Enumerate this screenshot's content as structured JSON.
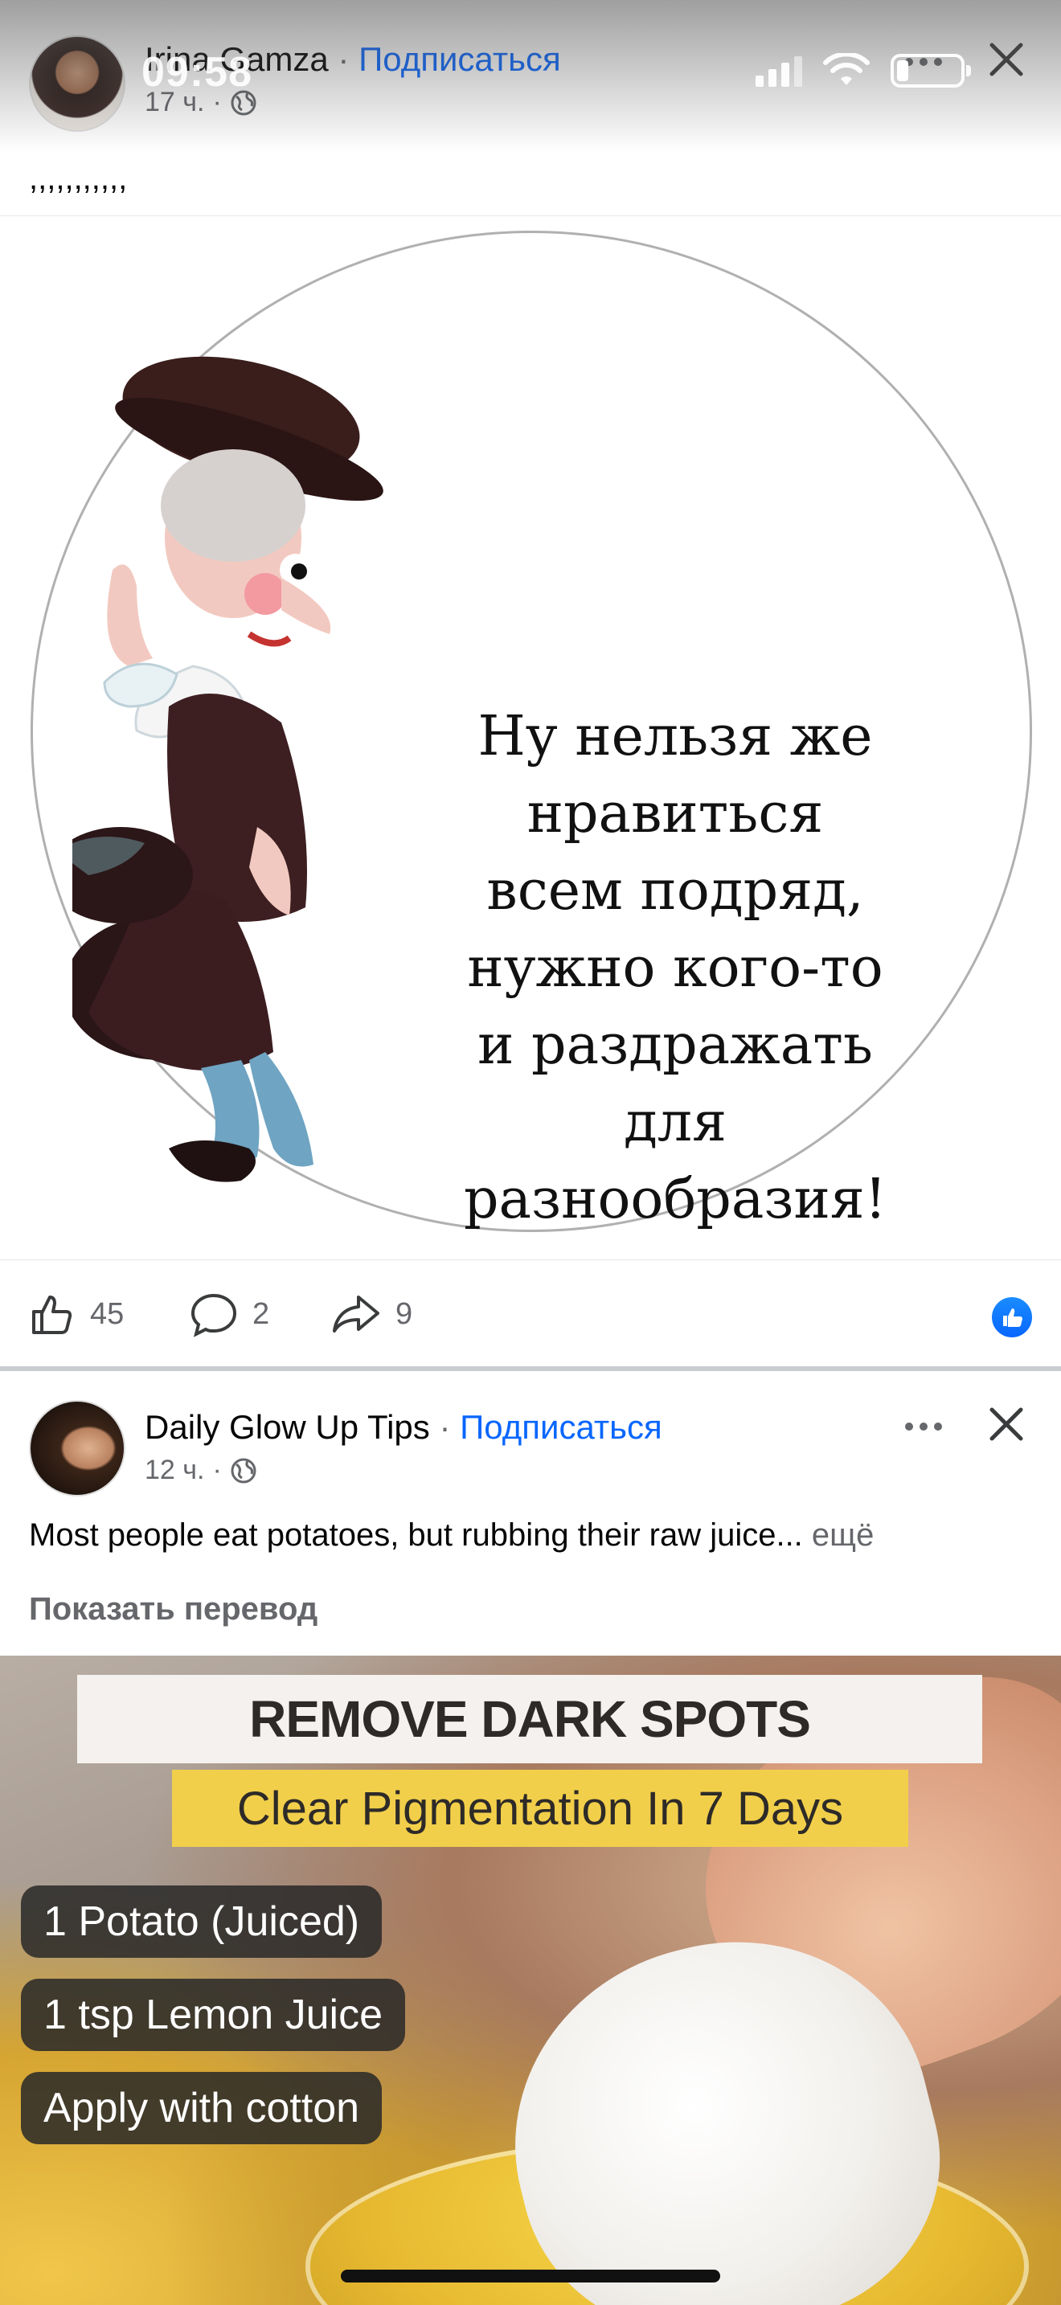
{
  "status_bar": {
    "time": "09:58"
  },
  "post1": {
    "author": "Irina Gamza",
    "separator": "·",
    "subscribe": "Подписаться",
    "time": "17 ч.",
    "meta_separator": "·",
    "text": ",,,,,,,,,,,",
    "meme_lines": [
      "Ну нельзя же",
      "нравиться",
      "всем подряд,",
      "нужно кого-то",
      "и раздражать",
      "для",
      "разнообразия!"
    ],
    "reactions": {
      "likes": "45",
      "comments": "2",
      "shares": "9"
    }
  },
  "post2": {
    "author": "Daily Glow Up Tips",
    "separator": "·",
    "subscribe": "Подписаться",
    "time": "12 ч.",
    "meta_separator": "·",
    "text": "Most people eat potatoes, but rubbing their raw juice...",
    "see_more": "ещё",
    "translate": "Показать перевод",
    "image": {
      "title": "REMOVE DARK SPOTS",
      "subtitle": "Clear Pigmentation In 7 Days",
      "steps": [
        "1 Potato (Juiced)",
        "1 tsp Lemon Juice",
        "Apply with cotton"
      ]
    },
    "avatar_text": "Daily Glow Up Tips"
  },
  "icons": {
    "like": "thumbs-up-outline",
    "comment": "speech-bubble-outline",
    "share": "share-arrow-outline",
    "close": "x-mark",
    "more": "three-dots",
    "audience": "globe",
    "like_badge": "blue-thumbs-up"
  },
  "colors": {
    "subscribe": "#0866ff",
    "meta": "#65676b",
    "like_badge": "#0866ff"
  }
}
